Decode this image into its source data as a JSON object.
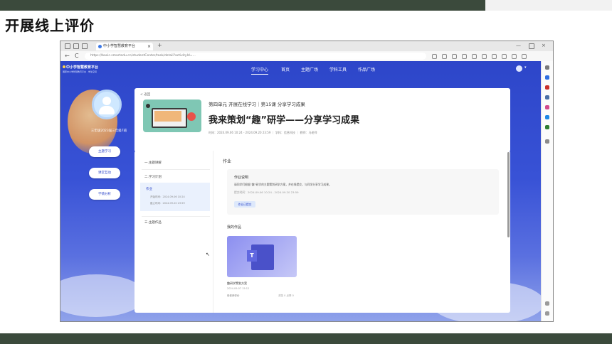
{
  "slide": {
    "title": "开展线上评价"
  },
  "browser": {
    "tab_title": "中小学智慧教育平台",
    "tab_close": "×",
    "new_tab": "+",
    "url": "https://basic.smartedu.cn/studentCenter/task/detail?activityId=...",
    "back": "←",
    "refresh": "C",
    "minimize": "—",
    "close": "×"
  },
  "site": {
    "logo": "中小学智慧教育平台",
    "logo_sub": "国家中小学智慧教育平台 · 学生空间",
    "nav": [
      "学习中心",
      "首页",
      "主题广场",
      "学科工具",
      "作品广场"
    ]
  },
  "student": {
    "name": "三年级2023届三年级7班",
    "buttons": [
      "主题学习",
      "课堂互动",
      "学情分析"
    ]
  },
  "lesson": {
    "back": "< 返回",
    "breadcrumb": "第四单元 开展在线学习｜第15课 分享学习成果",
    "title": "我来策划“趣”研学——分享学习成果",
    "meta": "时间：2024.09.06 10:24 - 2024.09.20 23:59 ｜ 学科：信息科技 ｜ 教师：马老师"
  },
  "steps": [
    {
      "label": "一.主题讲解"
    },
    {
      "label": "二.学习计划"
    },
    {
      "label": "三.主题作品"
    }
  ],
  "active_step": {
    "label": "作业",
    "line1": "开始时间：2024.09.06 10:24",
    "line2": "截止时间：2024.09.20 23:59"
  },
  "homework": {
    "section": "作业",
    "heading": "作业说明",
    "desc": "请同学们根据“趣”研学的主题策划研学方案，并在线提交，与同学分享学习成果。",
    "time": "提交时间：2024.09.06 10:24 - 2024.09.20 23:59",
    "button": "作业已提交"
  },
  "works": {
    "title": "我的作品",
    "item_name": "趣研学策划方案",
    "item_date": "2024.09.07 15:12",
    "status": "待老师评价",
    "count": "浏览 0 点赞 0"
  }
}
